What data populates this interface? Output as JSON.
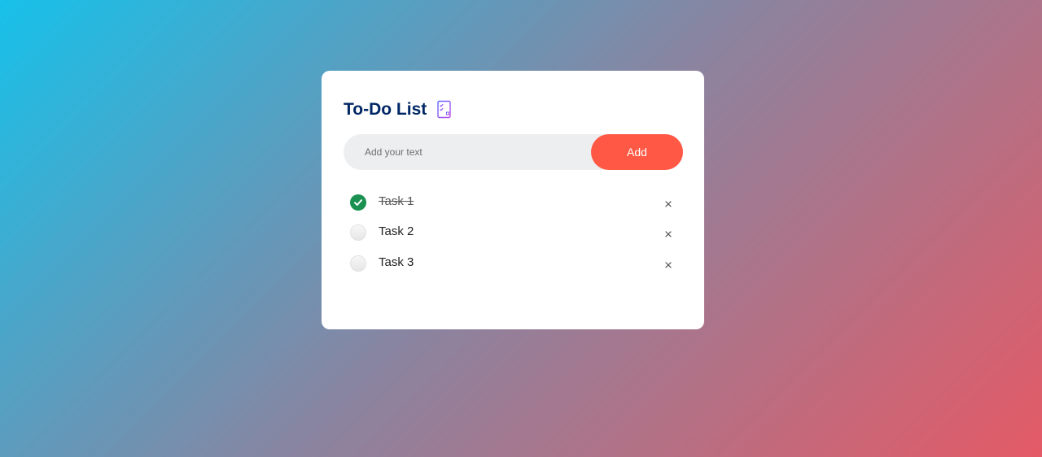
{
  "app": {
    "title": "To-Do List",
    "title_icon": "checklist-icon"
  },
  "input": {
    "value": "",
    "placeholder": "Add your text"
  },
  "add_button": {
    "label": "Add"
  },
  "tasks": [
    {
      "text": "Task 1",
      "done": true
    },
    {
      "text": "Task 2",
      "done": false
    },
    {
      "text": "Task 3",
      "done": false
    }
  ],
  "delete_symbol": "×",
  "colors": {
    "title": "#002765",
    "accent": "#ff5945",
    "checked": "#1a9150",
    "input_bg": "#edeef0"
  }
}
